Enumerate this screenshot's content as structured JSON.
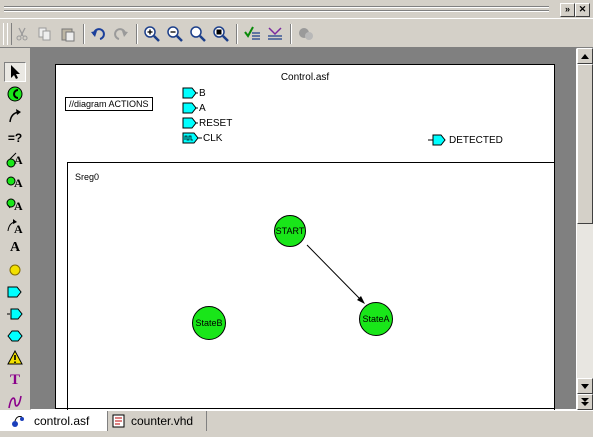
{
  "window": {
    "restore_button": "»",
    "close_button": "✕"
  },
  "toolbar": {
    "buttons": [
      "cut-icon",
      "copy-icon",
      "paste-icon",
      "undo-icon",
      "redo-icon",
      "zoom-in-icon",
      "zoom-out-icon",
      "zoom-fit-icon",
      "zoom-window-icon",
      "check-icon",
      "generate-icon",
      "simulate-icon"
    ]
  },
  "palette": {
    "tools": [
      "select-tool",
      "state-tool",
      "transition-tool",
      "condition-tool",
      "action-tool-1",
      "action-tool-2",
      "action-tool-3",
      "action-tool-4",
      "text-tool",
      "state-circle-tool",
      "input-port-tool",
      "output-port-tool",
      "bidir-port-tool",
      "warning-tool",
      "label-tool",
      "wire-tool"
    ],
    "condition_label": "=?",
    "text_tool_label": "A",
    "label_tool_label": "T"
  },
  "diagram": {
    "title": "Control.asf",
    "actions_box": "//diagram ACTIONS",
    "input_ports": [
      "B",
      "A",
      "RESET",
      "CLK"
    ],
    "clock_symbol": "⎍⎍",
    "output_port": "DETECTED",
    "sreg_label": "Sreg0",
    "states": [
      "START",
      "StateA",
      "StateB"
    ],
    "state_color": "#19e619",
    "port_color": "#00ffff"
  },
  "tabs": [
    {
      "label": "control.asf",
      "active": true
    },
    {
      "label": "counter.vhd",
      "active": false
    }
  ]
}
